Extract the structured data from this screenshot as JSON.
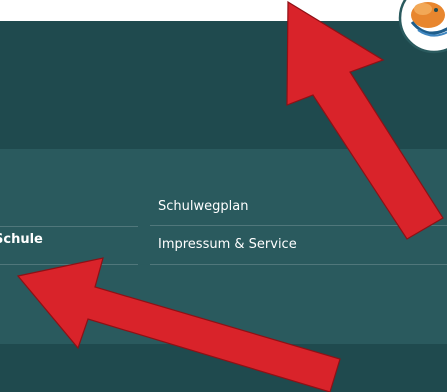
{
  "nav": {
    "left_item": "Schule",
    "right_items": [
      "Schulwegplan",
      "Impressum & Service"
    ]
  },
  "logo": {
    "icon": "school-mascot-logo"
  },
  "annotations": {
    "arrow_color": "#d9232a",
    "icon": "red-arrow-icon"
  },
  "colors": {
    "header": "#1f4a4e",
    "nav_panel": "#2a5a5e",
    "text": "#ffffff",
    "logo_orange": "#e8862e"
  }
}
